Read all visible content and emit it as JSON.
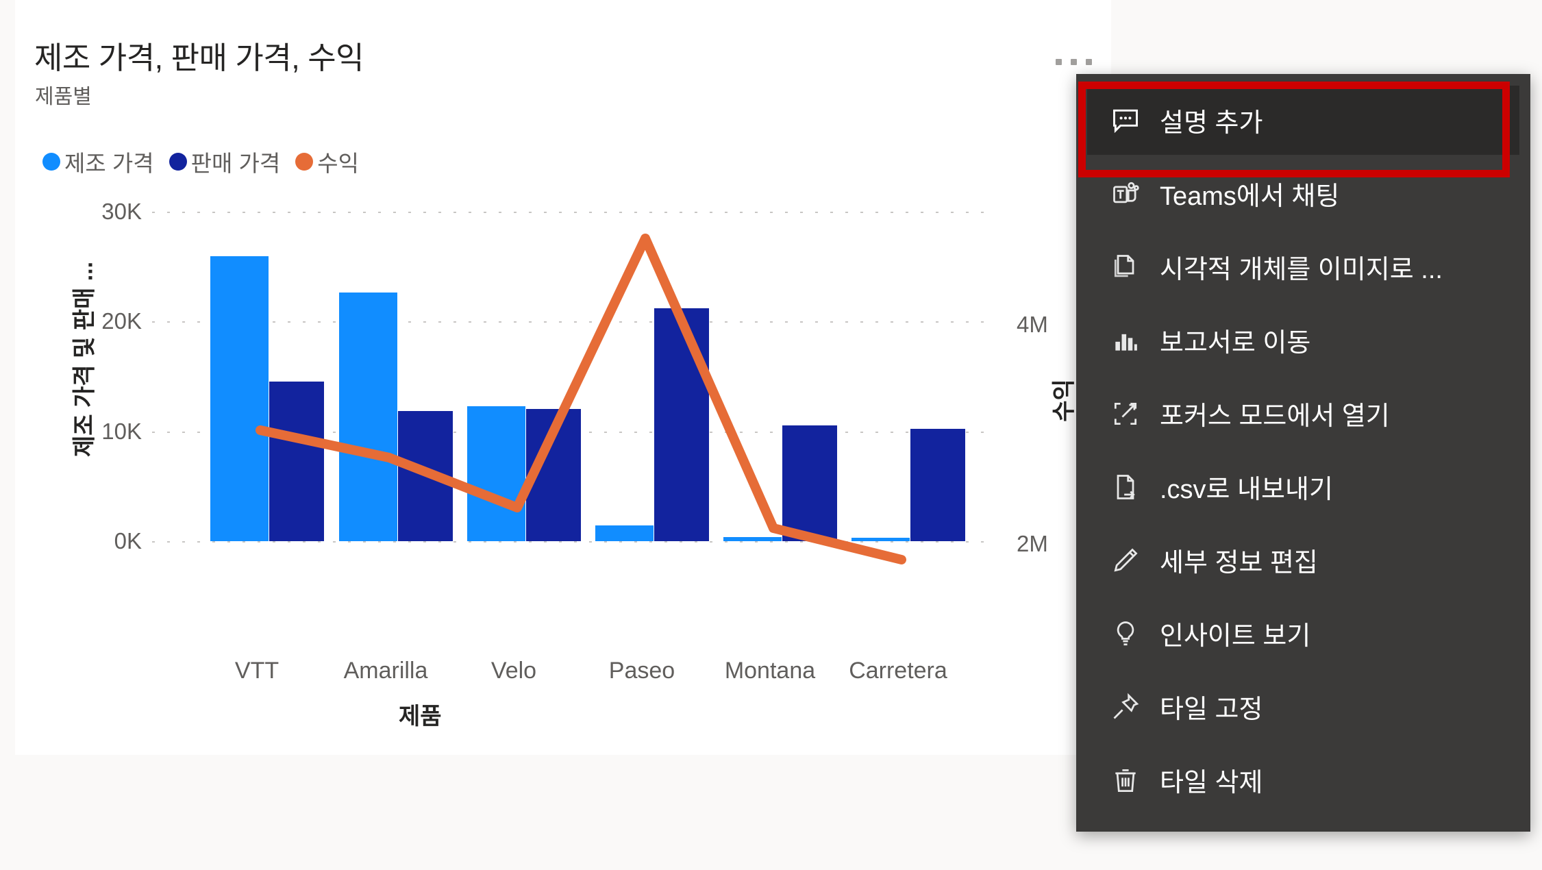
{
  "tile": {
    "title": "제조 가격, 판매 가격, 수익",
    "subtitle": "제품별",
    "more_options_label": "더 많은 옵션"
  },
  "legend": [
    {
      "label": "제조 가격",
      "color": "#118dff"
    },
    {
      "label": "판매 가격",
      "color": "#12239e"
    },
    {
      "label": "수익",
      "color": "#e66c37"
    }
  ],
  "context_menu": {
    "items": [
      {
        "label": "설명 추가",
        "icon": "comment-icon",
        "highlighted": true
      },
      {
        "label": "Teams에서 채팅",
        "icon": "teams-icon",
        "highlighted": false
      },
      {
        "label": "시각적 개체를 이미지로 ...",
        "icon": "copy-icon",
        "highlighted": false
      },
      {
        "label": "보고서로 이동",
        "icon": "bar-chart-icon",
        "highlighted": false
      },
      {
        "label": "포커스 모드에서 열기",
        "icon": "focus-mode-icon",
        "highlighted": false
      },
      {
        "label": ".csv로 내보내기",
        "icon": "export-file-icon",
        "highlighted": false
      },
      {
        "label": "세부 정보 편집",
        "icon": "pencil-icon",
        "highlighted": false
      },
      {
        "label": "인사이트 보기",
        "icon": "lightbulb-icon",
        "highlighted": false
      },
      {
        "label": "타일 고정",
        "icon": "pin-icon",
        "highlighted": false
      },
      {
        "label": "타일 삭제",
        "icon": "trash-icon",
        "highlighted": false
      }
    ],
    "highlight_color": "#cc0000"
  },
  "chart_data": {
    "type": "bar",
    "title": "제조 가격, 판매 가격, 수익",
    "subtitle": "제품별",
    "xlabel": "제품",
    "ylabel": "제조 가격 및 판매 ...",
    "y2label": "수익",
    "categories": [
      "VTT",
      "Amarilla",
      "Velo",
      "Paseo",
      "Montana",
      "Carretera"
    ],
    "ylim": [
      0,
      31500
    ],
    "yticks": [
      "0K",
      "10K",
      "20K",
      "30K"
    ],
    "ytick_values": [
      0,
      10000,
      20000,
      30000
    ],
    "y2lim": [
      0,
      5000000
    ],
    "y2ticks": [
      "2M",
      "4M"
    ],
    "y2tick_values": [
      2000000,
      4000000
    ],
    "grid": true,
    "legend_position": "top-left",
    "series": [
      {
        "name": "제조 가격",
        "type": "bar",
        "color": "#118dff",
        "axis": "left",
        "values": [
          26000,
          23200,
          12300,
          1450,
          350,
          280
        ]
      },
      {
        "name": "판매 가격",
        "type": "bar",
        "color": "#12239e",
        "axis": "left",
        "values": [
          14600,
          11900,
          12100,
          21200,
          10500,
          10200
        ]
      },
      {
        "name": "수익",
        "type": "line",
        "color": "#e66c37",
        "axis": "right",
        "values": [
          2860000,
          2610000,
          2040000,
          4680000,
          2460000,
          2160000
        ]
      }
    ]
  }
}
